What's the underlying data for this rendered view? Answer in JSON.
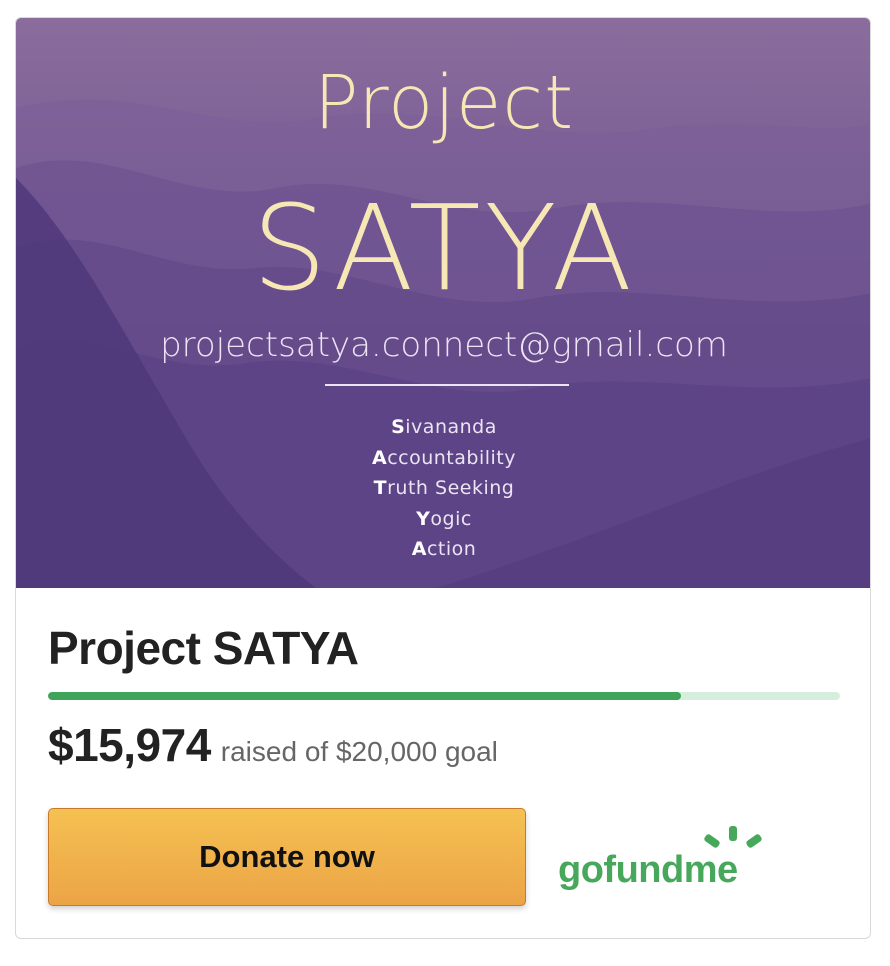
{
  "campaign": {
    "image": {
      "title_line1": "Project",
      "title_line2": "SATYA",
      "email": "projectsatya.connect@gmail.com",
      "acronym": [
        {
          "initial": "S",
          "rest": "ivananda"
        },
        {
          "initial": "A",
          "rest": "ccountability"
        },
        {
          "initial": "T",
          "rest": "ruth Seeking"
        },
        {
          "initial": "Y",
          "rest": "ogic"
        },
        {
          "initial": "A",
          "rest": "ction"
        }
      ]
    },
    "title": "Project SATYA",
    "progress_fraction": 0.7987,
    "amount_raised": "$15,974",
    "raised_text": "raised of $20,000 goal",
    "donate_label": "Donate now",
    "brand": "gofundme",
    "colors": {
      "progress_fill": "#3ea45a",
      "progress_track": "#d6efdd",
      "donate_button": "#f0b24c",
      "brand_green": "#47a85c",
      "hero_purple": "#5d4685"
    },
    "icons": [
      "gofundme-sun-icon"
    ]
  }
}
